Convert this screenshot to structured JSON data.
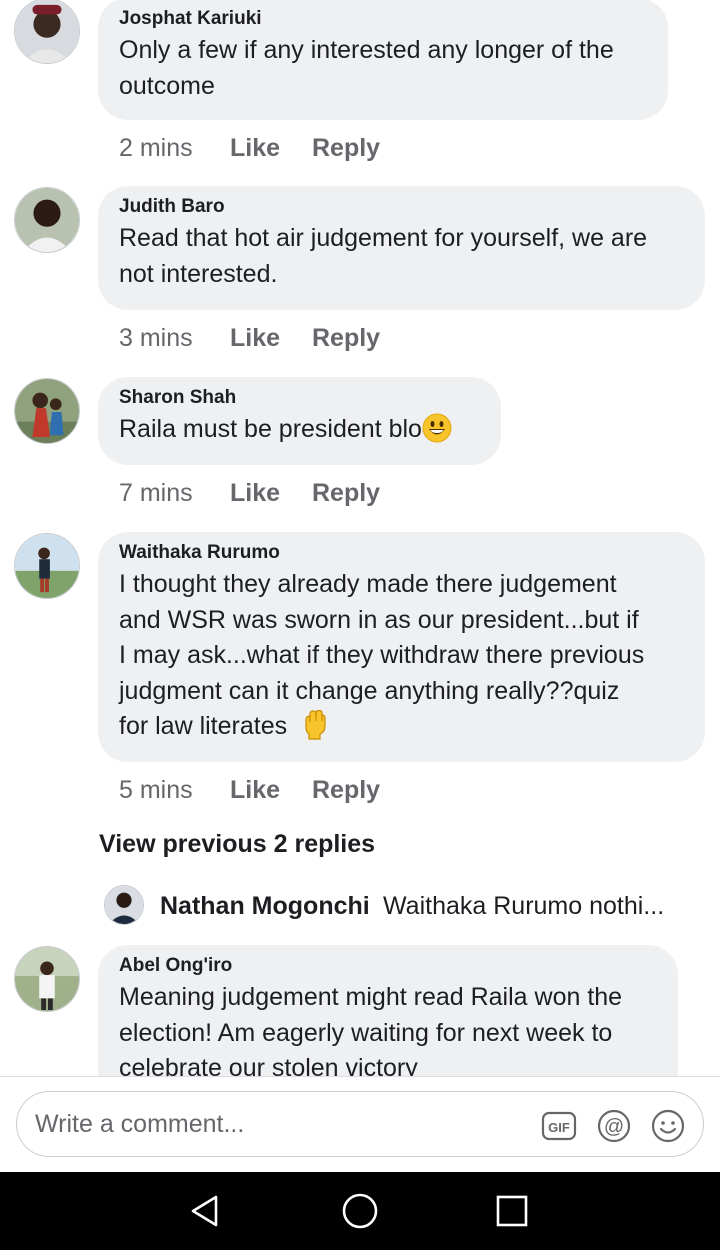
{
  "comments": [
    {
      "author": "Josphat Kariuki",
      "lines": [
        "Only a few if any interested any longer of the",
        "outcome"
      ],
      "time": "2 mins",
      "like": "Like",
      "reply": "Reply"
    },
    {
      "author": "Judith Baro",
      "lines": [
        "Read that hot air judgement for yourself, we are",
        "not interested."
      ],
      "time": "3 mins",
      "like": "Like",
      "reply": "Reply"
    },
    {
      "author": "Sharon Shah",
      "lines": [
        "Raila must be president blo"
      ],
      "emoji": "grinning-face-emoji",
      "time": "7 mins",
      "like": "Like",
      "reply": "Reply"
    },
    {
      "author": "Waithaka Rurumo",
      "lines": [
        "I thought they already made there judgement",
        "and WSR was sworn in as our president...but if",
        "I may ask...what if they withdraw there previous",
        "judgment can it change anything really??quiz",
        "for law literates"
      ],
      "emoji": "raised-fist-emoji",
      "time": "5 mins",
      "like": "Like",
      "reply": "Reply"
    },
    {
      "author": "Abel Ong'iro",
      "lines": [
        "Meaning judgement might read Raila won the",
        "election! Am eagerly waiting for next week to",
        "celebrate our stolen victory"
      ]
    }
  ],
  "view_previous": "View previous 2 replies",
  "nested_reply": {
    "author": "Nathan Mogonchi",
    "snippet": "Waithaka Rurumo nothi..."
  },
  "composer": {
    "placeholder": "Write a comment...",
    "tools": [
      "gif-icon",
      "mention-icon",
      "emoji-icon"
    ]
  },
  "navbar": {
    "buttons": [
      "back-icon",
      "home-icon",
      "recents-icon"
    ]
  },
  "colors": {
    "bubble": "#eff0f2",
    "meta_text": "#65676b",
    "navbar": "#000000"
  }
}
